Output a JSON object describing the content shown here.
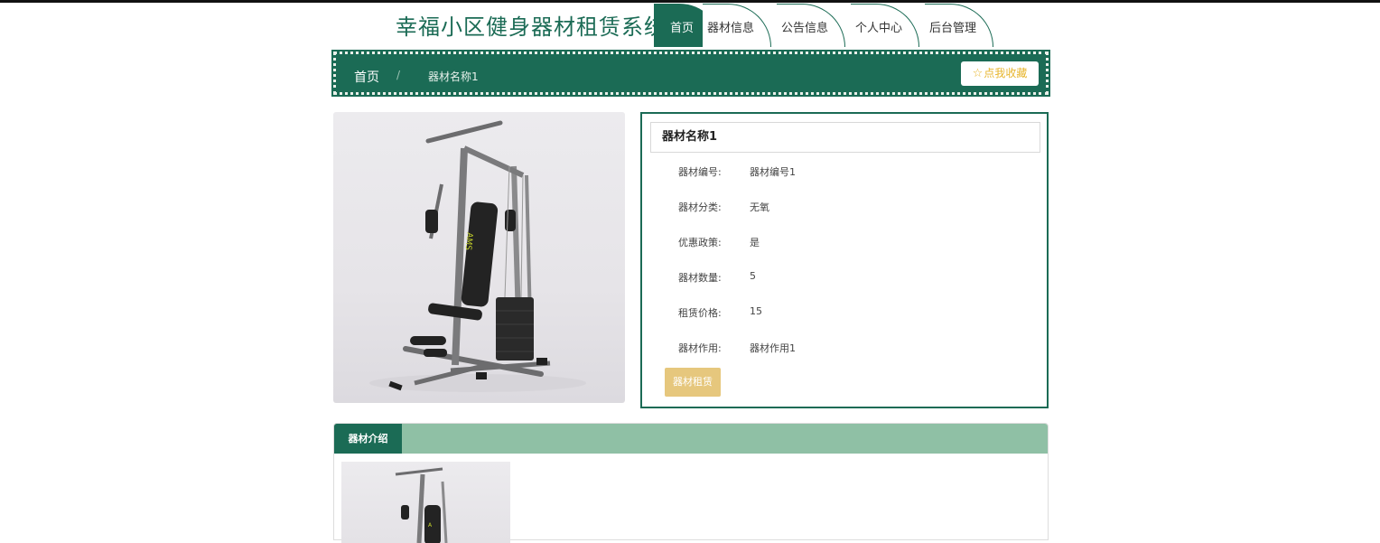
{
  "header": {
    "site_title": "幸福小区健身器材租赁系统",
    "nav": [
      {
        "label": "首页",
        "active": true
      },
      {
        "label": "器材信息",
        "active": false
      },
      {
        "label": "公告信息",
        "active": false
      },
      {
        "label": "个人中心",
        "active": false
      },
      {
        "label": "后台管理",
        "active": false
      }
    ]
  },
  "breadcrumb": {
    "home": "首页",
    "separator": "/",
    "current": "器材名称1",
    "favorite_label": "点我收藏"
  },
  "detail": {
    "title": "器材名称1",
    "rows": [
      {
        "label": "器材编号:",
        "value": "器材编号1"
      },
      {
        "label": "器材分类:",
        "value": "无氧"
      },
      {
        "label": "优惠政策:",
        "value": "是"
      },
      {
        "label": "器材数量:",
        "value": "5"
      },
      {
        "label": "租赁价格:",
        "value": "15"
      },
      {
        "label": "器材作用:",
        "value": "器材作用1"
      }
    ],
    "rent_button": "器材租赁"
  },
  "intro": {
    "tab_label": "器材介绍"
  },
  "images": {
    "main": "gym-machine-photo",
    "intro": "gym-machine-photo"
  },
  "colors": {
    "primary": "#1b6b55",
    "tab_bar": "#8fc0a5",
    "button": "#e6c77d",
    "favorite_text": "#e7b52c"
  }
}
